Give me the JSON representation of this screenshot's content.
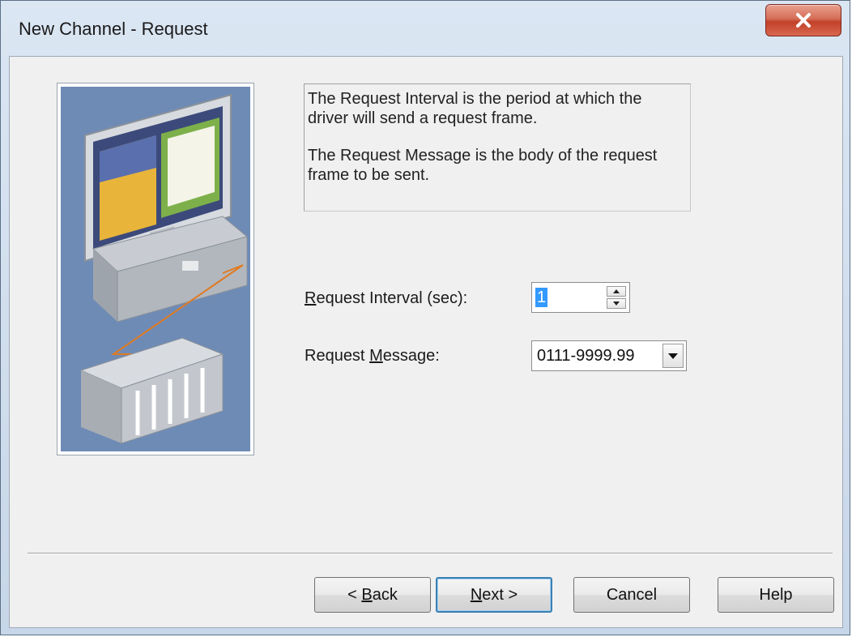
{
  "window": {
    "title": "New Channel - Request",
    "close_glyph": "X"
  },
  "illustration": {
    "icon": "computer-plc-illustration",
    "background_color": "#6e8bb6"
  },
  "description": {
    "paragraph1": "The Request Interval is the period at which the driver will send a request frame.",
    "paragraph2": "The Request Message is the body of the request frame to be sent."
  },
  "fields": {
    "interval": {
      "label_mnemonic": "R",
      "label_rest": "equest Interval (sec):",
      "value": "1"
    },
    "message": {
      "label_prefix": "Request ",
      "label_mnemonic": "M",
      "label_rest": "essage:",
      "value": "0111-9999.99"
    }
  },
  "buttons": {
    "back": {
      "prefix": "< ",
      "mnemonic": "B",
      "rest": "ack"
    },
    "next": {
      "mnemonic": "N",
      "rest": "ext >"
    },
    "cancel": "Cancel",
    "help": "Help"
  }
}
